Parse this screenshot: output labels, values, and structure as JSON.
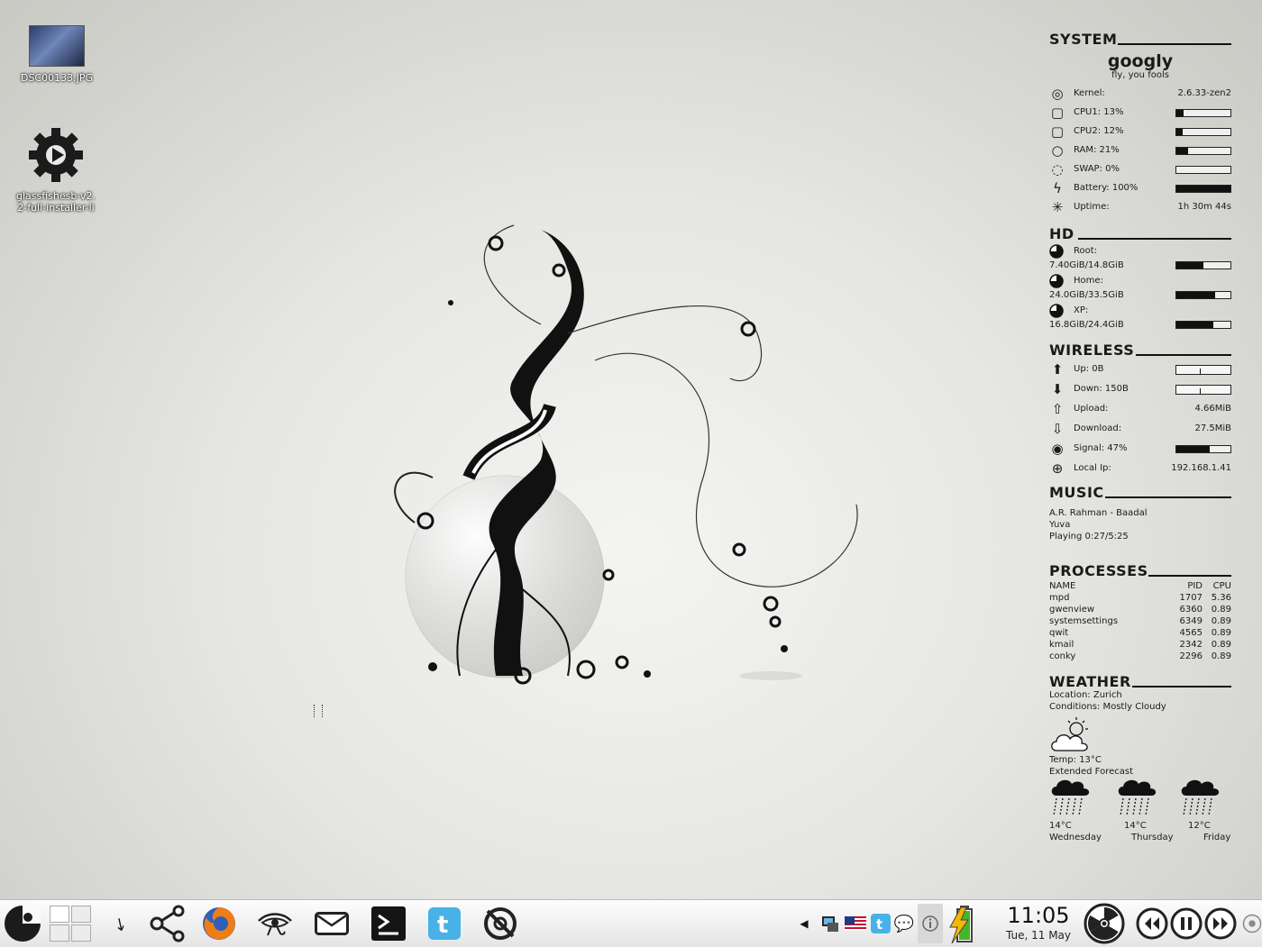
{
  "desktop": {
    "icons": [
      {
        "label": "DSC00133.JPG"
      },
      {
        "label_line1": "glassfishesb-v2.",
        "label_line2": "2-full-installer-li"
      }
    ]
  },
  "conky": {
    "system": {
      "title": "SYSTEM",
      "hostname": "googly",
      "tagline": "fly, you fools",
      "kernel_label": "Kernel:",
      "kernel_value": "2.6.33-zen2",
      "cpu1_label": "CPU1: 13%",
      "cpu1_level": 0.13,
      "cpu2_label": "CPU2: 12%",
      "cpu2_level": 0.12,
      "ram_label": "RAM: 21%",
      "ram_level": 0.21,
      "swap_label": "SWAP: 0%",
      "swap_level": 0.0,
      "battery_label": "Battery: 100%",
      "battery_level": 1.0,
      "uptime_label": "Uptime:",
      "uptime_value": "1h 30m 44s"
    },
    "hd": {
      "title": "HD",
      "root_label": "Root:",
      "root_size": "7.40GiB/14.8GiB",
      "root_level": 0.5,
      "home_label": "Home:",
      "home_size": "24.0GiB/33.5GiB",
      "home_level": 0.72,
      "xp_label": "XP:",
      "xp_size": "16.8GiB/24.4GiB",
      "xp_level": 0.69
    },
    "wireless": {
      "title": "WIRELESS",
      "up_label": "Up: 0B",
      "down_label": "Down: 150B",
      "upload_label": "Upload:",
      "upload_value": "4.66MiB",
      "download_label": "Download:",
      "download_value": "27.5MiB",
      "signal_label": "Signal: 47%",
      "signal_level": 0.62,
      "ip_label": "Local Ip:",
      "ip_value": "192.168.1.41"
    },
    "music": {
      "title": "MUSIC",
      "track": "A.R. Rahman - Baadal",
      "album": "Yuva",
      "status": "Playing 0:27/5:25"
    },
    "processes": {
      "title": "PROCESSES",
      "headers": {
        "name": "NAME",
        "pid": "PID",
        "cpu": "CPU"
      },
      "rows": [
        {
          "name": "mpd",
          "pid": "1707",
          "cpu": "5.36"
        },
        {
          "name": "gwenview",
          "pid": "6360",
          "cpu": "0.89"
        },
        {
          "name": "systemsettings",
          "pid": "6349",
          "cpu": "0.89"
        },
        {
          "name": "qwit",
          "pid": "4565",
          "cpu": "0.89"
        },
        {
          "name": "kmail",
          "pid": "2342",
          "cpu": "0.89"
        },
        {
          "name": "conky",
          "pid": "2296",
          "cpu": "0.89"
        }
      ]
    },
    "weather": {
      "title": "WEATHER",
      "location": "Location: Zurich",
      "conditions": "Conditions: Mostly Cloudy",
      "temp": "Temp: 13°C",
      "extended": "Extended Forecast",
      "forecast": [
        {
          "temp": "14°C",
          "day": "Wednesday"
        },
        {
          "temp": "14°C",
          "day": "Thursday"
        },
        {
          "temp": "12°C",
          "day": "Friday"
        }
      ]
    }
  },
  "taskbar": {
    "clock_time": "11:05",
    "clock_date": "Tue, 11 May",
    "battery_level": 1.0
  }
}
